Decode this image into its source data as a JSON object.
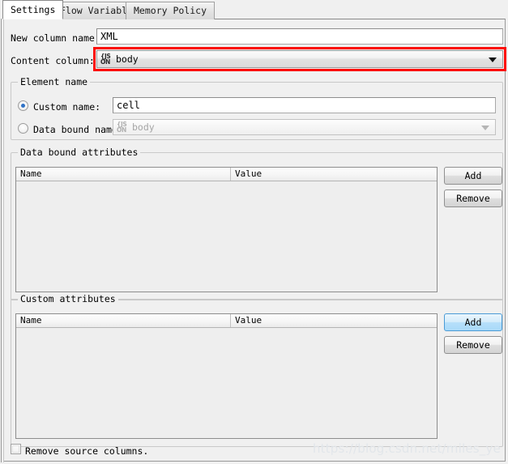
{
  "window": {
    "title": "Settings"
  },
  "tabs": [
    {
      "label": "Settings",
      "active": true
    },
    {
      "label": "Flow Variables",
      "active": false
    },
    {
      "label": "Memory Policy",
      "active": false
    }
  ],
  "form": {
    "new_column_name_label": "New column name:",
    "new_column_name_value": "XML",
    "new_column_name_placeholder": "",
    "content_column_label": "Content column:",
    "content_column_value": "body",
    "content_column_icon": "json-cell-type-icon",
    "content_column_icon_top": "{JS",
    "content_column_icon_bottom": "ON"
  },
  "element_name_group": {
    "title": "Element name",
    "custom_name_label": "Custom name:",
    "custom_name_selected": true,
    "custom_name_value": "cell",
    "data_bound_name_label": "Data bound name:",
    "data_bound_name_selected": false,
    "data_bound_name_value": "body",
    "data_bound_name_icon_top": "{JS",
    "data_bound_name_icon_bottom": "ON"
  },
  "data_bound_attributes": {
    "title": "Data bound attributes",
    "columns": [
      "Name",
      "Value"
    ],
    "rows": [],
    "add_label": "Add",
    "remove_label": "Remove",
    "add_focused": false
  },
  "custom_attributes": {
    "title": "Custom attributes",
    "columns": [
      "Name",
      "Value"
    ],
    "rows": [],
    "add_label": "Add",
    "remove_label": "Remove",
    "add_focused": true
  },
  "footer": {
    "remove_source_columns_label": "Remove source columns.",
    "remove_source_columns_checked": false
  },
  "watermark": "https://blog.csdn.net/miles_ye",
  "colors": {
    "highlight_red": "#fb0b06",
    "focus_blue": "#4a9bd6",
    "radio_dot_blue": "#2f72c6",
    "panel_background": "#f0f0f0",
    "field_background": "#ffffff",
    "table_body": "#eeeeee",
    "watermark_grey": "#e2e6ea"
  }
}
